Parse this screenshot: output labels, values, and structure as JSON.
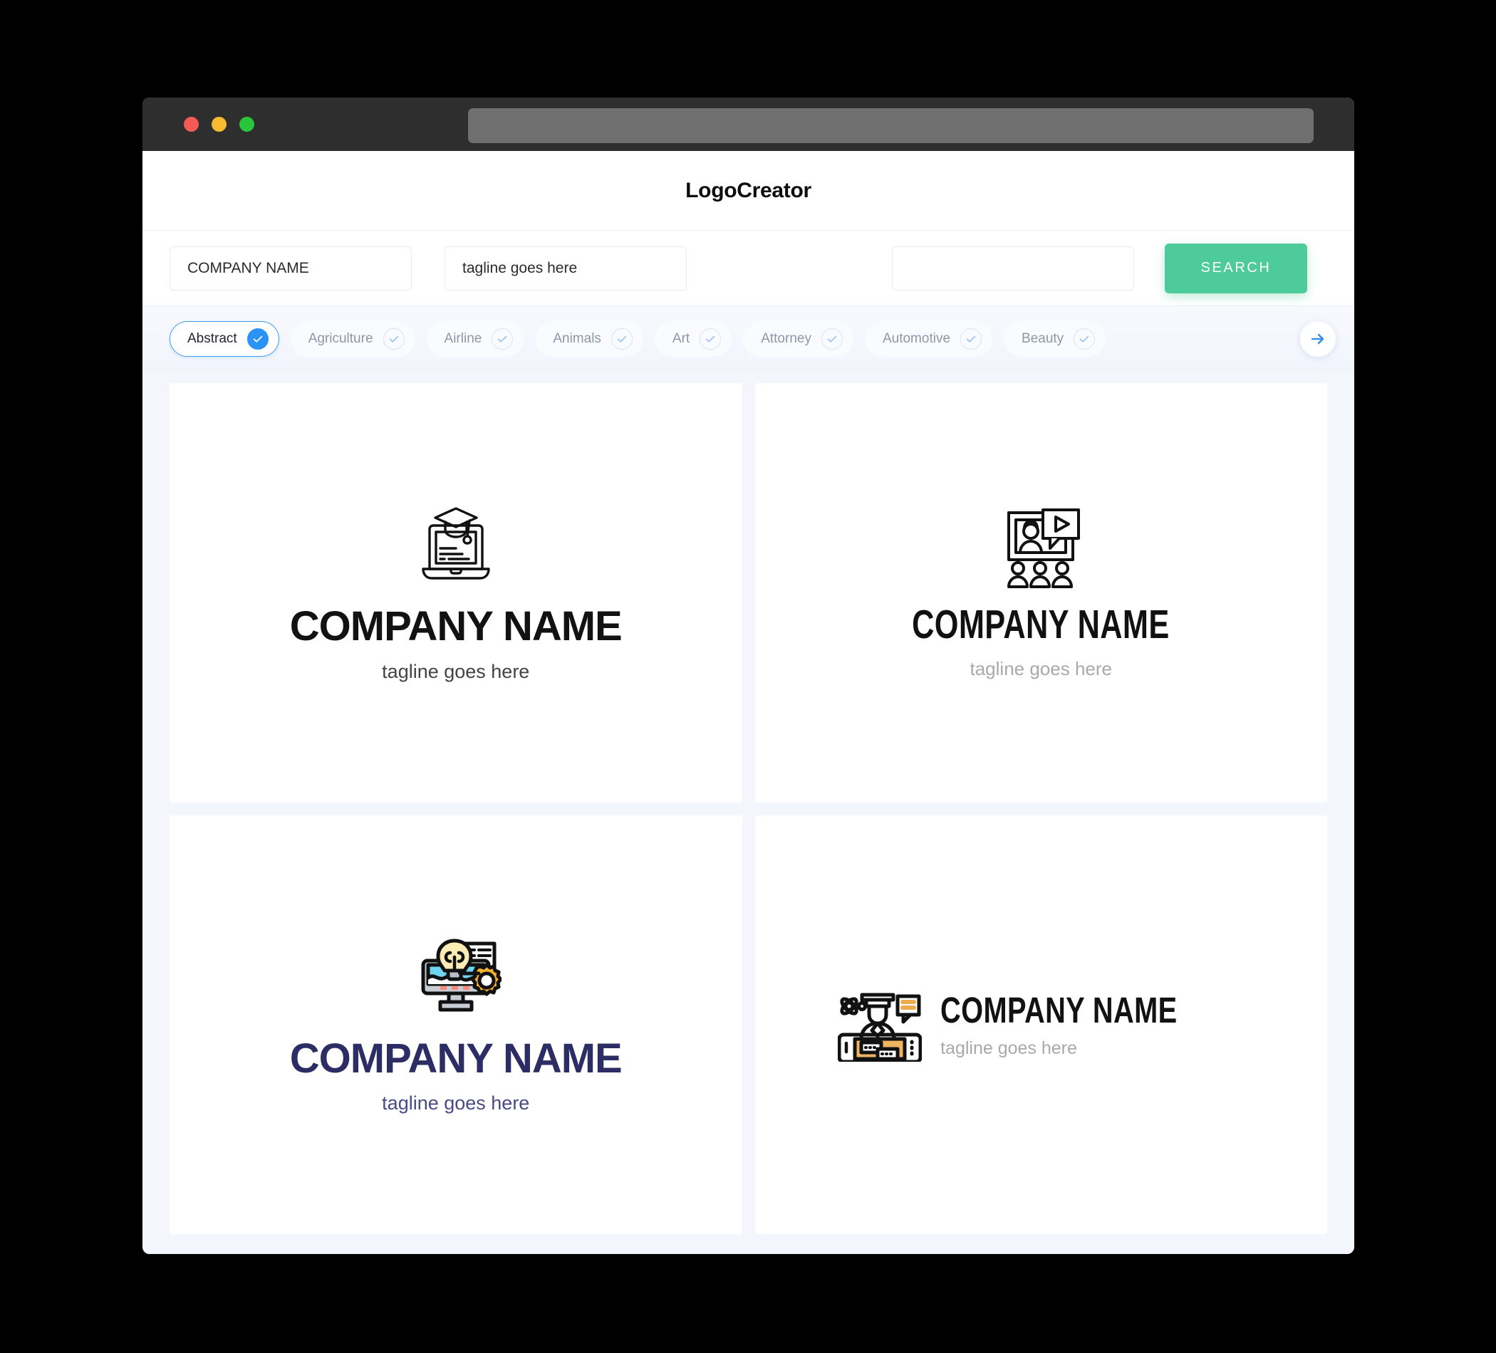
{
  "browser": {
    "traffic_lights": [
      "close",
      "minimize",
      "maximize"
    ],
    "url_value": ""
  },
  "header": {
    "title": "LogoCreator"
  },
  "search": {
    "company_value": "COMPANY NAME",
    "company_placeholder": "COMPANY NAME",
    "tagline_value": "tagline goes here",
    "tagline_placeholder": "tagline goes here",
    "extra_value": "",
    "extra_placeholder": "",
    "button_label": "SEARCH",
    "button_color": "#4ecb9b"
  },
  "categories": {
    "accent_color": "#2b93f5",
    "items": [
      {
        "label": "Abstract",
        "selected": true
      },
      {
        "label": "Agriculture",
        "selected": false
      },
      {
        "label": "Airline",
        "selected": false
      },
      {
        "label": "Animals",
        "selected": false
      },
      {
        "label": "Art",
        "selected": false
      },
      {
        "label": "Attorney",
        "selected": false
      },
      {
        "label": "Automotive",
        "selected": false
      },
      {
        "label": "Beauty",
        "selected": false
      }
    ],
    "next_icon": "arrow-right-icon"
  },
  "results": {
    "logos": [
      {
        "id": "logo-laptop-graduation",
        "icon_name": "laptop-graduation-cap-icon",
        "name": "COMPANY NAME",
        "tagline": "tagline goes here",
        "name_color": "#121212",
        "tagline_color": "#444444",
        "layout": "stacked"
      },
      {
        "id": "logo-video-webinar",
        "icon_name": "video-presentation-audience-icon",
        "name": "COMPANY NAME",
        "tagline": "tagline goes here",
        "name_color": "#111111",
        "tagline_color": "#a9a9a9",
        "layout": "stacked"
      },
      {
        "id": "logo-monitor-idea",
        "icon_name": "monitor-lightbulb-gear-icon",
        "name": "COMPANY NAME",
        "tagline": "tagline goes here",
        "name_color": "#2d2d66",
        "tagline_color": "#4a4a85",
        "layout": "stacked"
      },
      {
        "id": "logo-graduate-tablet",
        "icon_name": "graduate-tablet-chat-icon",
        "name": "COMPANY NAME",
        "tagline": "tagline goes here",
        "name_color": "#121212",
        "tagline_color": "#a9a9a9",
        "layout": "horizontal"
      }
    ]
  }
}
